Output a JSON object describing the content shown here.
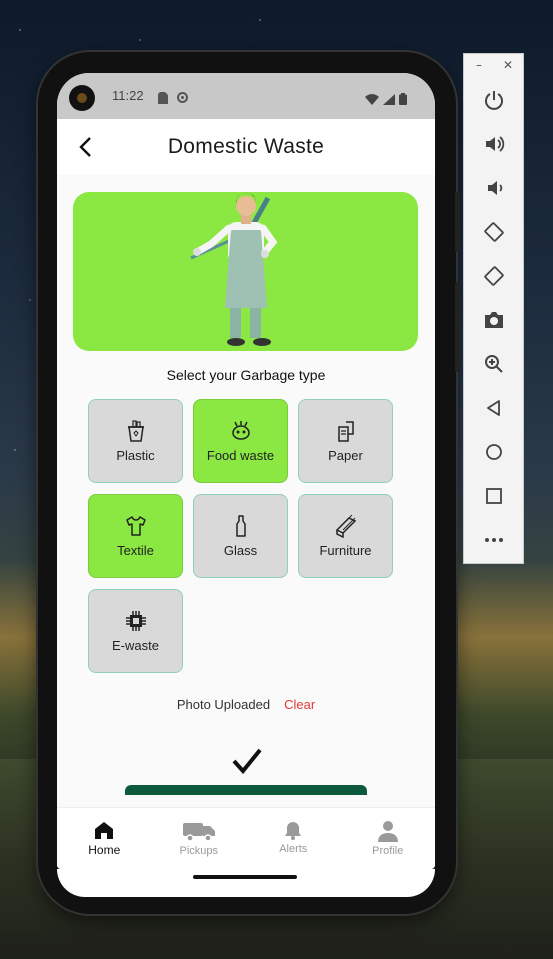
{
  "status_bar": {
    "time": "11:22"
  },
  "app_bar": {
    "title": "Domestic Waste"
  },
  "section_title": "Select your Garbage type",
  "garbage_types": [
    {
      "label": "Plastic",
      "icon": "plastic-bin-icon",
      "selected": false
    },
    {
      "label": "Food waste",
      "icon": "food-waste-icon",
      "selected": true
    },
    {
      "label": "Paper",
      "icon": "paper-icon",
      "selected": false
    },
    {
      "label": "Textile",
      "icon": "shirt-icon",
      "selected": true
    },
    {
      "label": "Glass",
      "icon": "bottle-icon",
      "selected": false
    },
    {
      "label": "Furniture",
      "icon": "wood-planks-icon",
      "selected": false
    },
    {
      "label": "E-waste",
      "icon": "chip-icon",
      "selected": false
    }
  ],
  "upload": {
    "status": "Photo Uploaded",
    "clear_label": "Clear"
  },
  "bottom_nav": [
    {
      "label": "Home",
      "icon": "home-icon",
      "active": true
    },
    {
      "label": "Pickups",
      "icon": "truck-icon",
      "active": false
    },
    {
      "label": "Alerts",
      "icon": "bell-icon",
      "active": false
    },
    {
      "label": "Profile",
      "icon": "person-icon",
      "active": false
    }
  ],
  "emulator_toolbar": {
    "items": [
      "power-icon",
      "volume-up-icon",
      "volume-down-icon",
      "rotate-left-icon",
      "rotate-right-icon",
      "camera-icon",
      "zoom-icon",
      "back-icon",
      "home-circle-icon",
      "overview-icon",
      "more-icon"
    ]
  },
  "colors": {
    "accent_green": "#8be842",
    "tile_gray": "#d9d9d9",
    "tile_border": "#8fd1b2",
    "submit_green": "#0c5a3b",
    "clear_red": "#e53935"
  }
}
